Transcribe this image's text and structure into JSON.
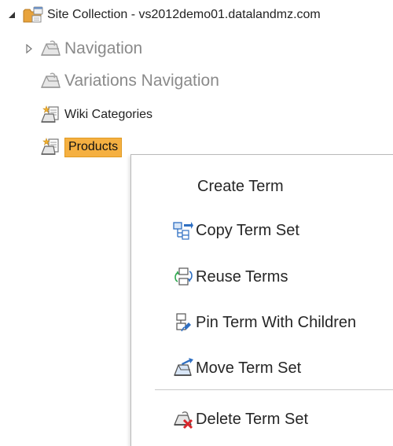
{
  "tree": {
    "site_collection": {
      "label": "Site Collection - vs2012demo01.datalandmz.com",
      "icon": "site-collection-folder-icon",
      "expanded": true
    },
    "items": [
      {
        "label": "Navigation",
        "icon": "term-set-icon",
        "faded": true,
        "has_children": true
      },
      {
        "label": "Variations Navigation",
        "icon": "term-set-icon",
        "faded": true,
        "has_children": false
      },
      {
        "label": "Wiki Categories",
        "icon": "term-group-icon",
        "faded": false,
        "has_children": false
      },
      {
        "label": "Products",
        "icon": "term-group-icon",
        "faded": false,
        "has_children": false,
        "selected": true
      }
    ]
  },
  "context_menu": {
    "items": [
      {
        "label": "Create Term",
        "icon": ""
      },
      {
        "label": "Copy Term Set",
        "icon": "copy-term-set-icon"
      },
      {
        "label": "Reuse Terms",
        "icon": "reuse-terms-icon"
      },
      {
        "label": "Pin Term With Children",
        "icon": "pin-term-icon"
      },
      {
        "label": "Move Term Set",
        "icon": "move-term-set-icon"
      },
      {
        "label": "Delete Term Set",
        "icon": "delete-term-set-icon"
      }
    ]
  },
  "colors": {
    "selection_highlight": "#f5b041",
    "faded_text": "#8a8a8a",
    "folder_orange": "#e8a33c",
    "delete_red": "#d9262b",
    "icon_blue": "#2f6fc2"
  }
}
